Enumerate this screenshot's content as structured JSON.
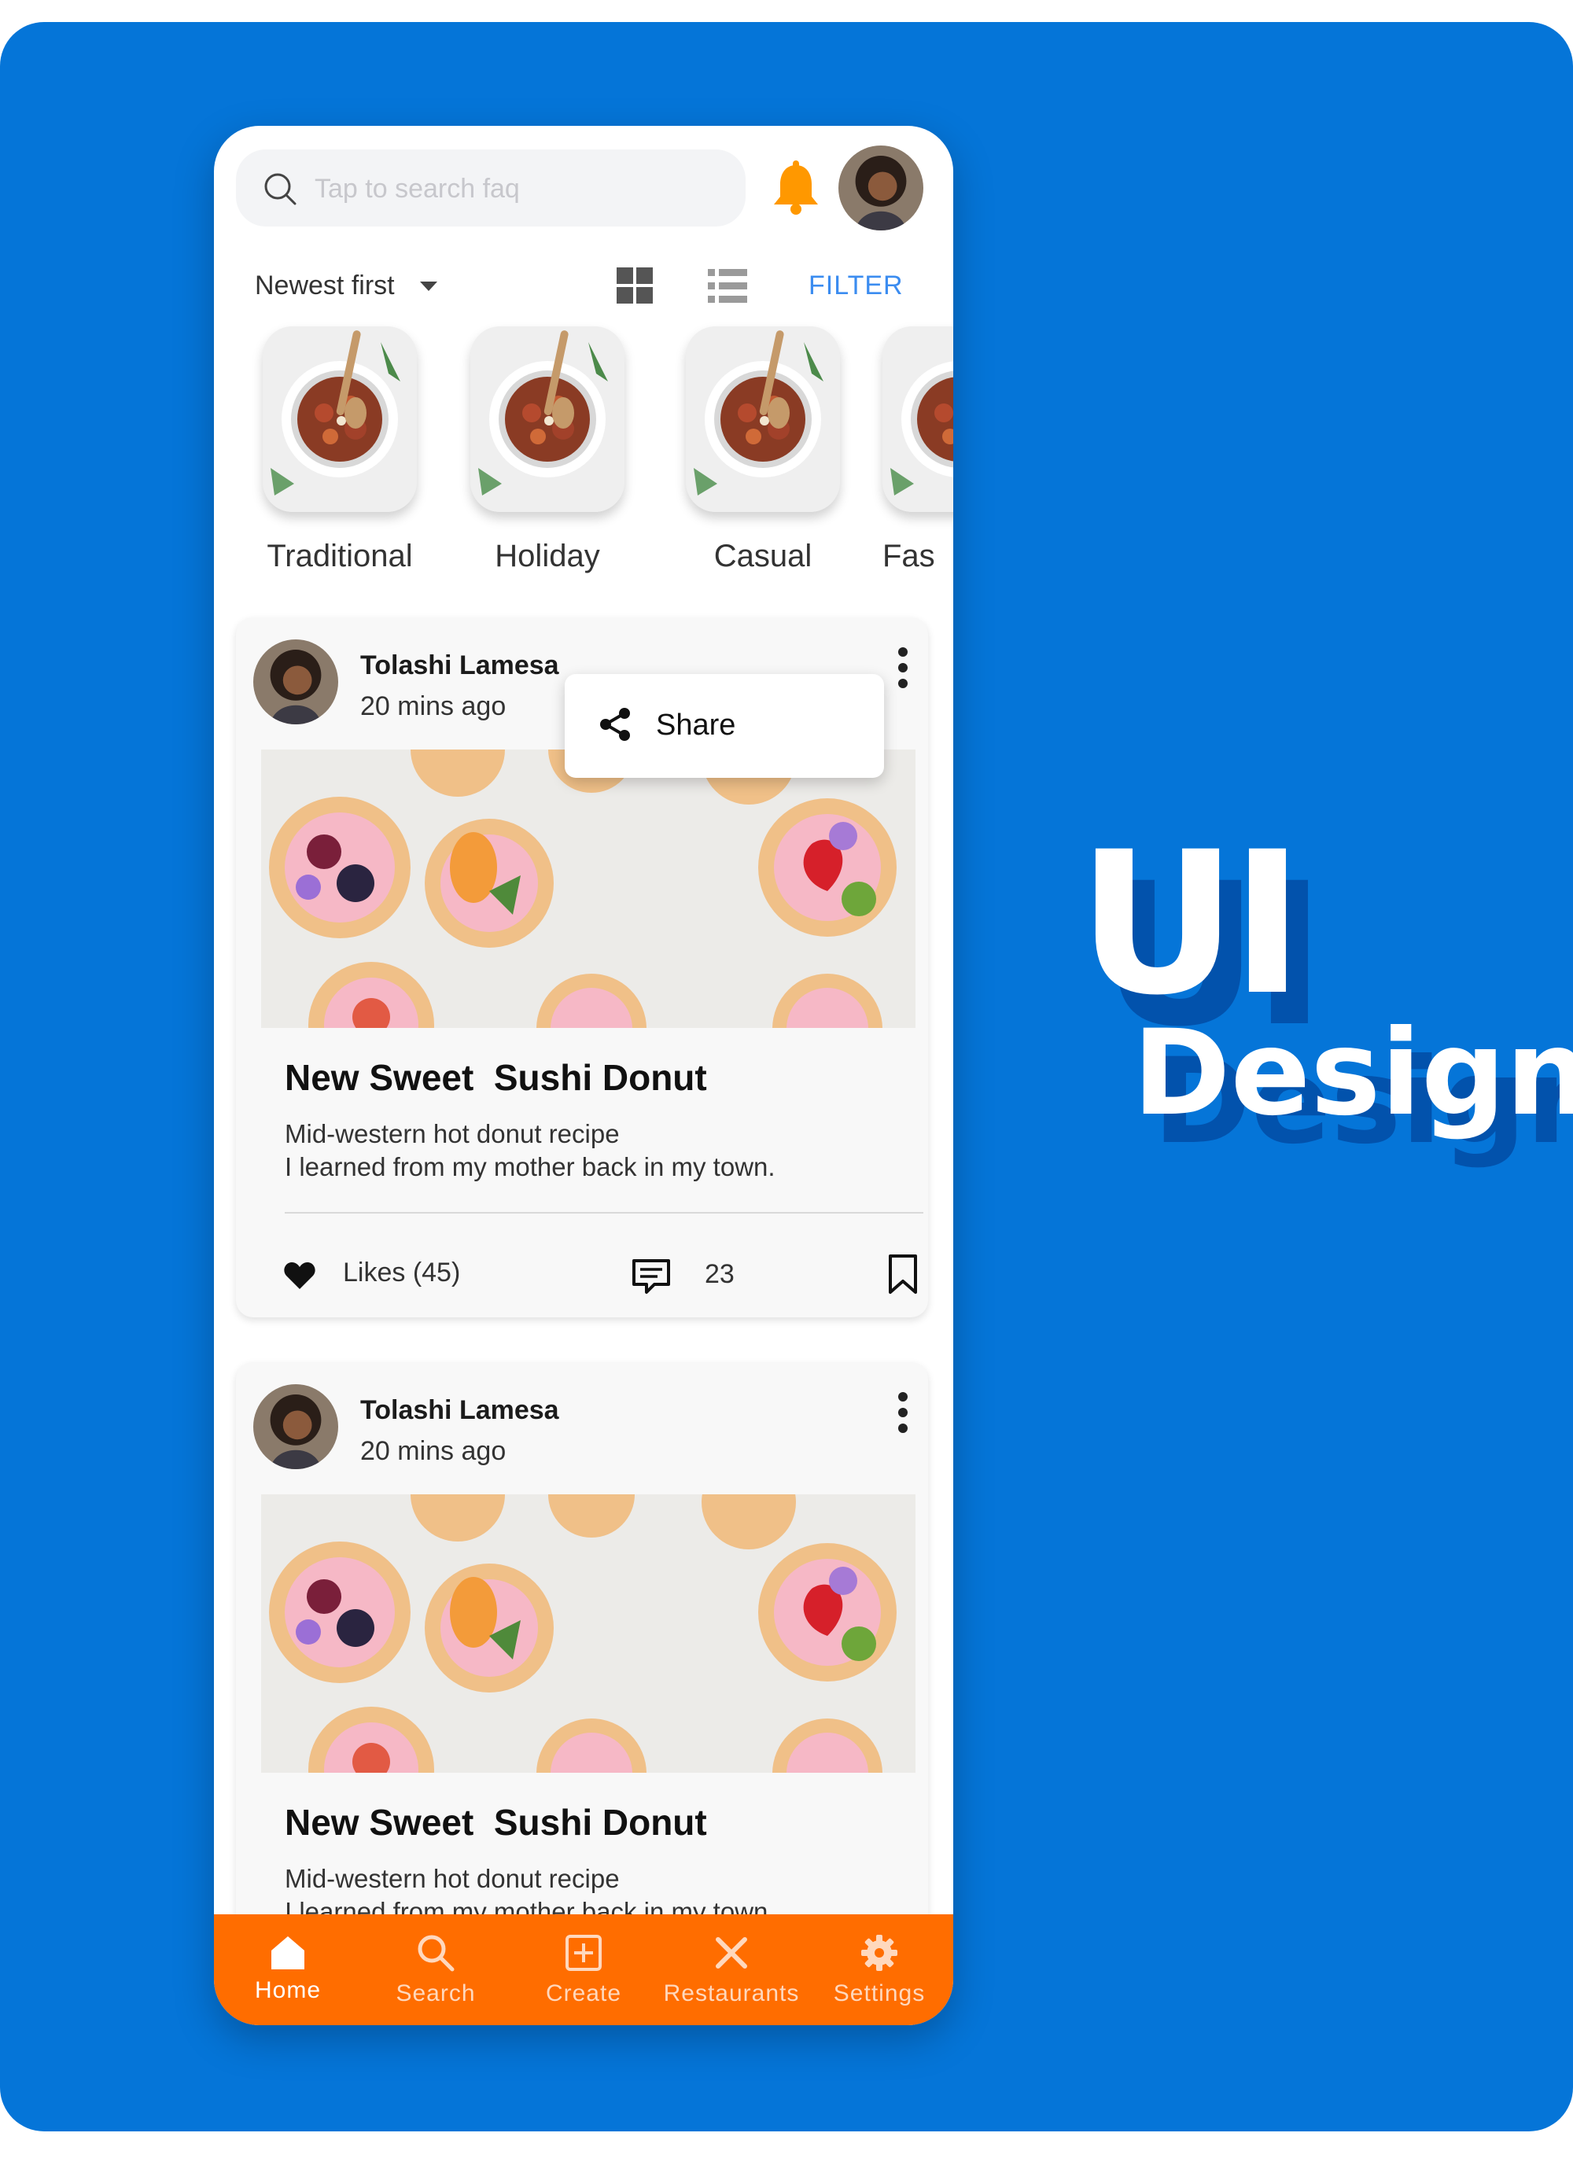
{
  "colors": {
    "background": "#0575d8",
    "accent": "#ff6d00",
    "link": "#3b8cf0",
    "bell": "#ff9800"
  },
  "search": {
    "placeholder": "Tap to search faq"
  },
  "toolbar": {
    "sort_label": "Newest first",
    "filter_label": "FILTER"
  },
  "categories": [
    {
      "label": "Traditional"
    },
    {
      "label": "Holiday"
    },
    {
      "label": "Casual"
    },
    {
      "label": "Fas"
    }
  ],
  "posts": [
    {
      "author": "Tolashi Lamesa",
      "time": "20 mins ago",
      "title": "New Sweet  Sushi Donut",
      "desc_line1": "Mid-western hot donut recipe",
      "desc_line2": "I learned from my mother back in my town.",
      "likes": "Likes (45)",
      "comments": "23"
    },
    {
      "author": "Tolashi Lamesa",
      "time": "20 mins ago",
      "title": "New Sweet  Sushi Donut",
      "desc_line1": "Mid-western hot donut recipe",
      "desc_line2": "I learned from my mother back in my town."
    }
  ],
  "popup": {
    "share_label": "Share"
  },
  "nav": [
    {
      "label": "Home",
      "icon": "home-icon",
      "active": true
    },
    {
      "label": "Search",
      "icon": "search-icon"
    },
    {
      "label": "Create",
      "icon": "plus-square-icon"
    },
    {
      "label": "Restaurants",
      "icon": "utensils-icon"
    },
    {
      "label": "Settings",
      "icon": "gear-icon"
    }
  ],
  "brand": {
    "line1": "UI",
    "line2": "Design"
  }
}
